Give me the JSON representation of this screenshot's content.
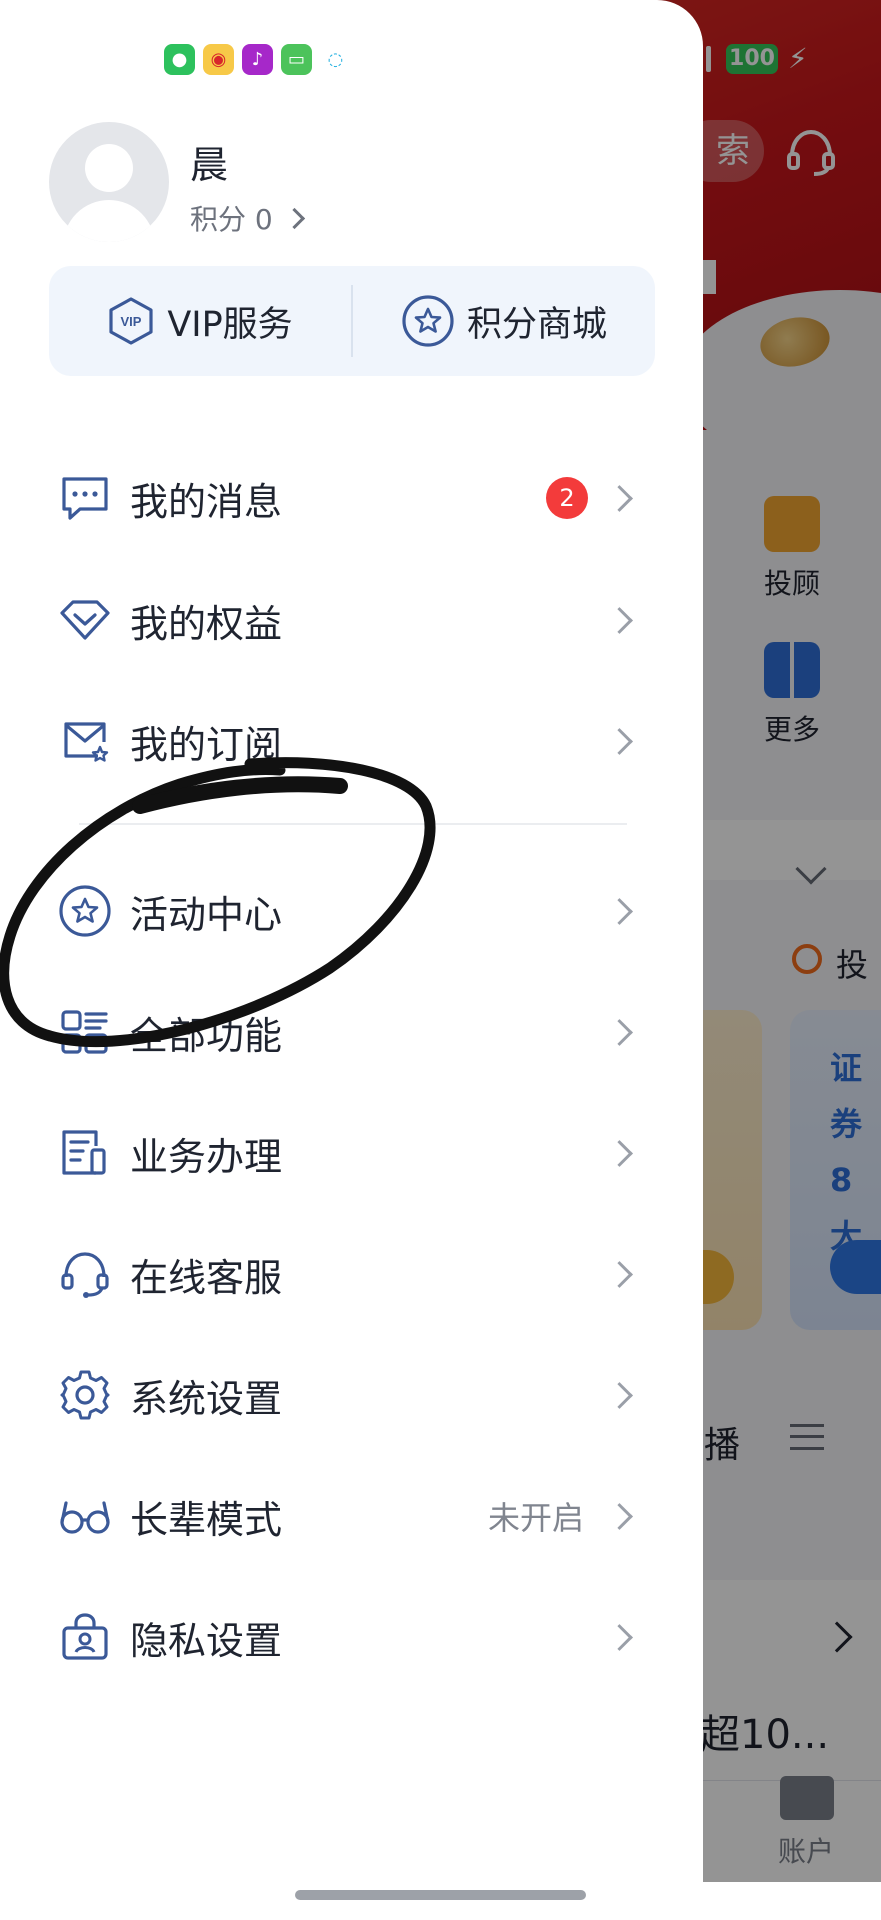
{
  "status_bar": {
    "app_icons": [
      "wechat-icon",
      "weibo-icon",
      "notification-bell-icon",
      "messages-icon",
      "chat-bubble-icon"
    ],
    "battery": "100"
  },
  "profile": {
    "name": "晨",
    "points": "积分 0"
  },
  "services": [
    {
      "label": "VIP服务",
      "icon": "vip-hexagon-icon"
    },
    {
      "label": "积分商城",
      "icon": "star-circle-icon"
    }
  ],
  "menu": {
    "items": [
      {
        "label": "我的消息",
        "icon": "message-icon",
        "badge": "2"
      },
      {
        "label": "我的权益",
        "icon": "diamond-icon"
      },
      {
        "label": "我的订阅",
        "icon": "subscription-icon"
      },
      {
        "label": "活动中心",
        "icon": "star-circle-icon"
      },
      {
        "label": "全部功能",
        "icon": "all-functions-icon"
      },
      {
        "label": "业务办理",
        "icon": "business-form-icon"
      },
      {
        "label": "在线客服",
        "icon": "headset-icon"
      },
      {
        "label": "系统设置",
        "icon": "gear-icon"
      },
      {
        "label": "长辈模式",
        "icon": "glasses-icon",
        "value": "未开启"
      },
      {
        "label": "隐私设置",
        "icon": "privacy-lock-icon"
      }
    ]
  },
  "background_app": {
    "search_fragment": "索",
    "tile_advisor": "投顾",
    "tile_more": "更多",
    "tou_fragment": "投",
    "card_text_1": "证券",
    "card_text_2": "8大",
    "bo_fragment": "播",
    "list_fragment": "超10...",
    "tab_account": "账户"
  },
  "colors": {
    "accent": "#3b5998",
    "badge_red": "#f33b3b",
    "banner_red": "#c8171b",
    "annotation_ink": "#111111"
  }
}
